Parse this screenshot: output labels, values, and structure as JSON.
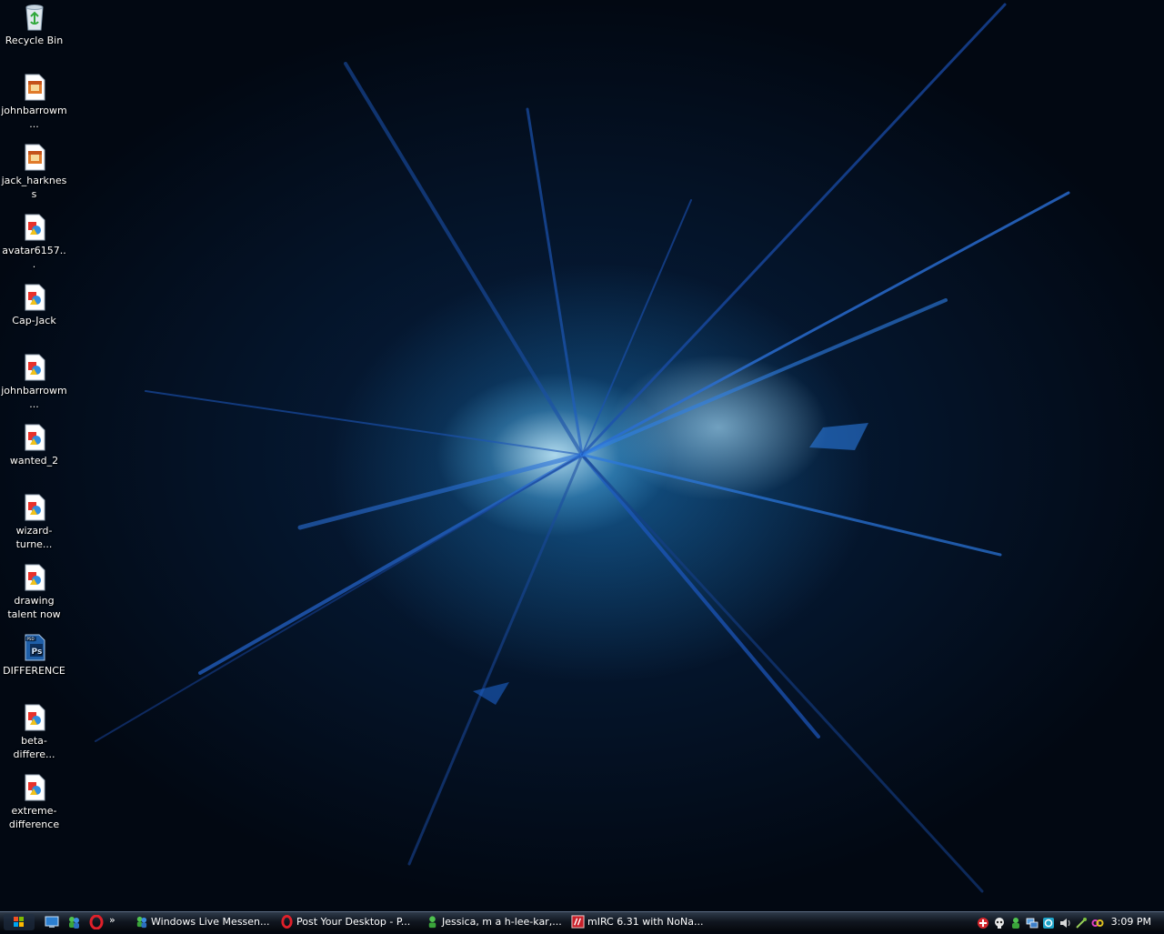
{
  "desktop": {
    "icons": [
      {
        "label": "Recycle Bin",
        "icon": "recycle-bin-icon"
      },
      {
        "label": "johnbarrowm...",
        "icon": "image-file-icon"
      },
      {
        "label": "jack_harkness",
        "icon": "image-file-icon"
      },
      {
        "label": "avatar6157...",
        "icon": "paint-image-icon"
      },
      {
        "label": "Cap-Jack",
        "icon": "paint-image-icon"
      },
      {
        "label": "johnbarrowm...",
        "icon": "paint-image-icon"
      },
      {
        "label": "wanted_2",
        "icon": "paint-image-icon"
      },
      {
        "label": "wizard-turne...",
        "icon": "paint-image-icon"
      },
      {
        "label": "drawing talent now",
        "icon": "paint-image-icon"
      },
      {
        "label": "DIFFERENCE",
        "icon": "photoshop-file-icon",
        "badge": "Ps"
      },
      {
        "label": "beta-differe...",
        "icon": "paint-image-icon"
      },
      {
        "label": "extreme-difference",
        "icon": "paint-image-icon"
      }
    ]
  },
  "taskbar": {
    "start_icon": "windows-start-icon",
    "tasks": [
      {
        "label": "Windows Live Messen...",
        "icon": "messenger-icon"
      },
      {
        "label": "Post Your Desktop - P...",
        "icon": "opera-icon"
      },
      {
        "label": "Jessica, m a h-lee-kar,...",
        "icon": "messenger-chat-icon"
      },
      {
        "label": "mIRC 6.31 with NoNa...",
        "icon": "mirc-icon"
      }
    ],
    "clock": "3:09 PM"
  },
  "colors": {
    "taskbar": "#10161f",
    "glow": "#7fd4ff"
  }
}
